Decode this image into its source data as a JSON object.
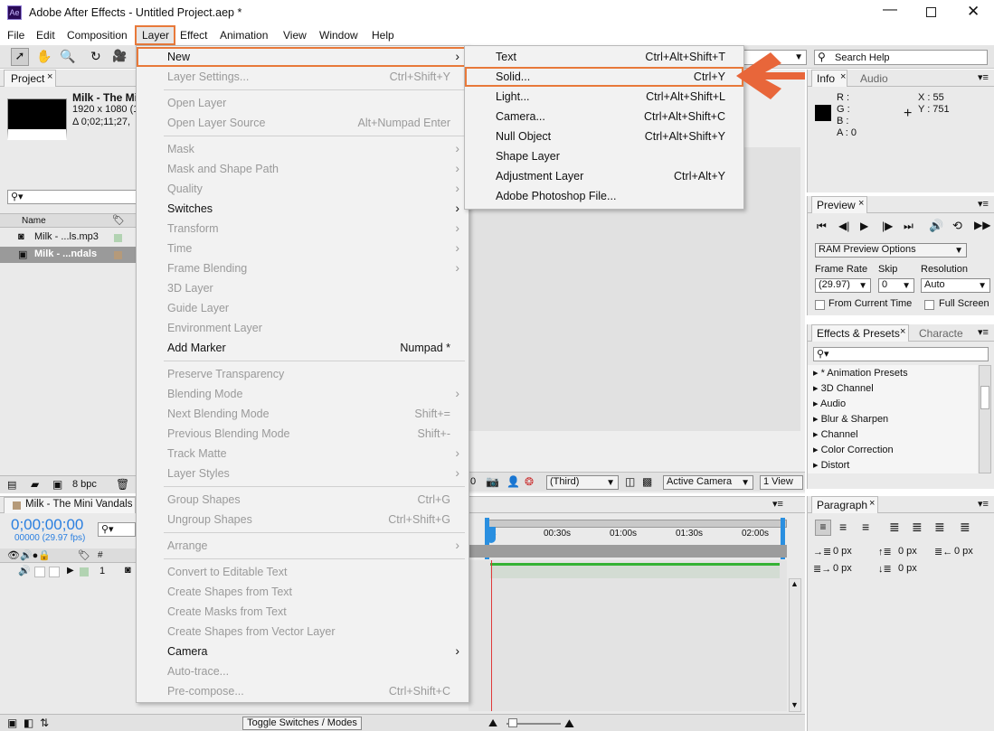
{
  "titlebar": {
    "logo": "Ae",
    "title": "Adobe After Effects - Untitled Project.aep *"
  },
  "menubar": [
    "File",
    "Edit",
    "Composition",
    "Layer",
    "Effect",
    "Animation",
    "View",
    "Window",
    "Help"
  ],
  "search_help": "Search Help",
  "project": {
    "tab": "Project",
    "comp_name": "Milk - The Mi",
    "comp_info1": "1920 x 1080 (1",
    "comp_info2": "Δ 0;02;11;27,",
    "col_name": "Name",
    "items": [
      "Milk - ...ls.mp3",
      "Milk - ...ndals"
    ],
    "bpc": "8 bpc"
  },
  "layer_menu": [
    {
      "label": "New",
      "shortcut": "",
      "arrow": true,
      "disabled": false
    },
    {
      "label": "Layer Settings...",
      "shortcut": "Ctrl+Shift+Y",
      "arrow": false,
      "disabled": true
    },
    {
      "sep": true
    },
    {
      "label": "Open Layer",
      "shortcut": "",
      "arrow": false,
      "disabled": true
    },
    {
      "label": "Open Layer Source",
      "shortcut": "Alt+Numpad Enter",
      "arrow": false,
      "disabled": true
    },
    {
      "sep": true
    },
    {
      "label": "Mask",
      "shortcut": "",
      "arrow": true,
      "disabled": true
    },
    {
      "label": "Mask and Shape Path",
      "shortcut": "",
      "arrow": true,
      "disabled": true
    },
    {
      "label": "Quality",
      "shortcut": "",
      "arrow": true,
      "disabled": true
    },
    {
      "label": "Switches",
      "shortcut": "",
      "arrow": true,
      "disabled": false
    },
    {
      "label": "Transform",
      "shortcut": "",
      "arrow": true,
      "disabled": true
    },
    {
      "label": "Time",
      "shortcut": "",
      "arrow": true,
      "disabled": true
    },
    {
      "label": "Frame Blending",
      "shortcut": "",
      "arrow": true,
      "disabled": true
    },
    {
      "label": "3D Layer",
      "shortcut": "",
      "arrow": false,
      "disabled": true
    },
    {
      "label": "Guide Layer",
      "shortcut": "",
      "arrow": false,
      "disabled": true
    },
    {
      "label": "Environment Layer",
      "shortcut": "",
      "arrow": false,
      "disabled": true
    },
    {
      "label": "Add Marker",
      "shortcut": "Numpad *",
      "arrow": false,
      "disabled": false
    },
    {
      "sep": true
    },
    {
      "label": "Preserve Transparency",
      "shortcut": "",
      "arrow": false,
      "disabled": true
    },
    {
      "label": "Blending Mode",
      "shortcut": "",
      "arrow": true,
      "disabled": true
    },
    {
      "label": "Next Blending Mode",
      "shortcut": "Shift+=",
      "arrow": false,
      "disabled": true
    },
    {
      "label": "Previous Blending Mode",
      "shortcut": "Shift+-",
      "arrow": false,
      "disabled": true
    },
    {
      "label": "Track Matte",
      "shortcut": "",
      "arrow": true,
      "disabled": true
    },
    {
      "label": "Layer Styles",
      "shortcut": "",
      "arrow": true,
      "disabled": true
    },
    {
      "sep": true
    },
    {
      "label": "Group Shapes",
      "shortcut": "Ctrl+G",
      "arrow": false,
      "disabled": true
    },
    {
      "label": "Ungroup Shapes",
      "shortcut": "Ctrl+Shift+G",
      "arrow": false,
      "disabled": true
    },
    {
      "sep": true
    },
    {
      "label": "Arrange",
      "shortcut": "",
      "arrow": true,
      "disabled": true
    },
    {
      "sep": true
    },
    {
      "label": "Convert to Editable Text",
      "shortcut": "",
      "arrow": false,
      "disabled": true
    },
    {
      "label": "Create Shapes from Text",
      "shortcut": "",
      "arrow": false,
      "disabled": true
    },
    {
      "label": "Create Masks from Text",
      "shortcut": "",
      "arrow": false,
      "disabled": true
    },
    {
      "label": "Create Shapes from Vector Layer",
      "shortcut": "",
      "arrow": false,
      "disabled": true
    },
    {
      "label": "Camera",
      "shortcut": "",
      "arrow": true,
      "disabled": false
    },
    {
      "label": "Auto-trace...",
      "shortcut": "",
      "arrow": false,
      "disabled": true
    },
    {
      "label": "Pre-compose...",
      "shortcut": "Ctrl+Shift+C",
      "arrow": false,
      "disabled": true
    }
  ],
  "new_menu": [
    {
      "label": "Text",
      "shortcut": "Ctrl+Alt+Shift+T"
    },
    {
      "label": "Solid...",
      "shortcut": "Ctrl+Y"
    },
    {
      "label": "Light...",
      "shortcut": "Ctrl+Alt+Shift+L"
    },
    {
      "label": "Camera...",
      "shortcut": "Ctrl+Alt+Shift+C"
    },
    {
      "label": "Null Object",
      "shortcut": "Ctrl+Alt+Shift+Y"
    },
    {
      "label": "Shape Layer",
      "shortcut": ""
    },
    {
      "label": "Adjustment Layer",
      "shortcut": "Ctrl+Alt+Y"
    },
    {
      "label": "Adobe Photoshop File...",
      "shortcut": ""
    }
  ],
  "info": {
    "tab": "Info",
    "tab2": "Audio",
    "r": "R :",
    "g": "G :",
    "b": "B :",
    "a": "A : 0",
    "x": "X : 55",
    "y": "Y : 751"
  },
  "preview": {
    "tab": "Preview",
    "ram": "RAM Preview Options",
    "frame_rate_label": "Frame Rate",
    "skip_label": "Skip",
    "resolution_label": "Resolution",
    "frame_rate": "(29.97)",
    "skip": "0",
    "resolution": "Auto",
    "from_current": "From Current Time",
    "full_screen": "Full Screen"
  },
  "effects": {
    "tab": "Effects & Presets",
    "tab2": "Characte",
    "items": [
      "* Animation Presets",
      "3D Channel",
      "Audio",
      "Blur & Sharpen",
      "Channel",
      "Color Correction",
      "Distort"
    ]
  },
  "paragraph": {
    "tab": "Paragraph",
    "v1": "0 px",
    "v2": "0 px",
    "v3": "0 px",
    "v4": "0 px",
    "v5": "0 px"
  },
  "viewer": {
    "third": "(Third)",
    "camera": "Active Camera",
    "views": "1 View",
    "zero": "0"
  },
  "timeline": {
    "tab": "Milk - The Mini Vandals",
    "timecode": "0;00;00;00",
    "fps": "00000 (29.97 fps)",
    "layer_num": "1",
    "ticks": [
      "00:30s",
      "01:00s",
      "01:30s",
      "02:00s"
    ],
    "toggle": "Toggle Switches / Modes"
  }
}
